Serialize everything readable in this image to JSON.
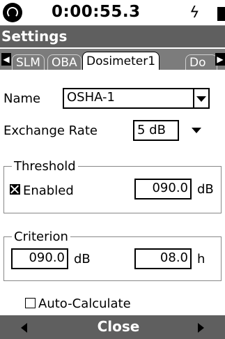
{
  "status": {
    "timer": "0:00:55.3",
    "power_icon": "lightning-bolt-icon",
    "battery_icon": "battery-icon"
  },
  "title": "Settings",
  "tabs": [
    "SLM",
    "OBA",
    "Dosimeter1",
    "Do"
  ],
  "active_tab": "Dosimeter1",
  "form": {
    "name_label": "Name",
    "name_value": "OSHA-1",
    "exchange_label": "Exchange Rate",
    "exchange_value": "5 dB"
  },
  "threshold": {
    "title": "Threshold",
    "enabled_label": "Enabled",
    "enabled": true,
    "value": "090.0",
    "unit": "dB"
  },
  "criterion": {
    "title": "Criterion",
    "level_value": "090.0",
    "level_unit": "dB",
    "time_value": "08.0",
    "time_unit": "h"
  },
  "auto_calculate": {
    "label": "Auto-Calculate",
    "checked": false
  },
  "bottom": {
    "close_label": "Close"
  },
  "colors": {
    "header_bg": "#5f5f5f",
    "tabbar_bg": "#7c7c7c",
    "page_bg": "#ffffff"
  }
}
